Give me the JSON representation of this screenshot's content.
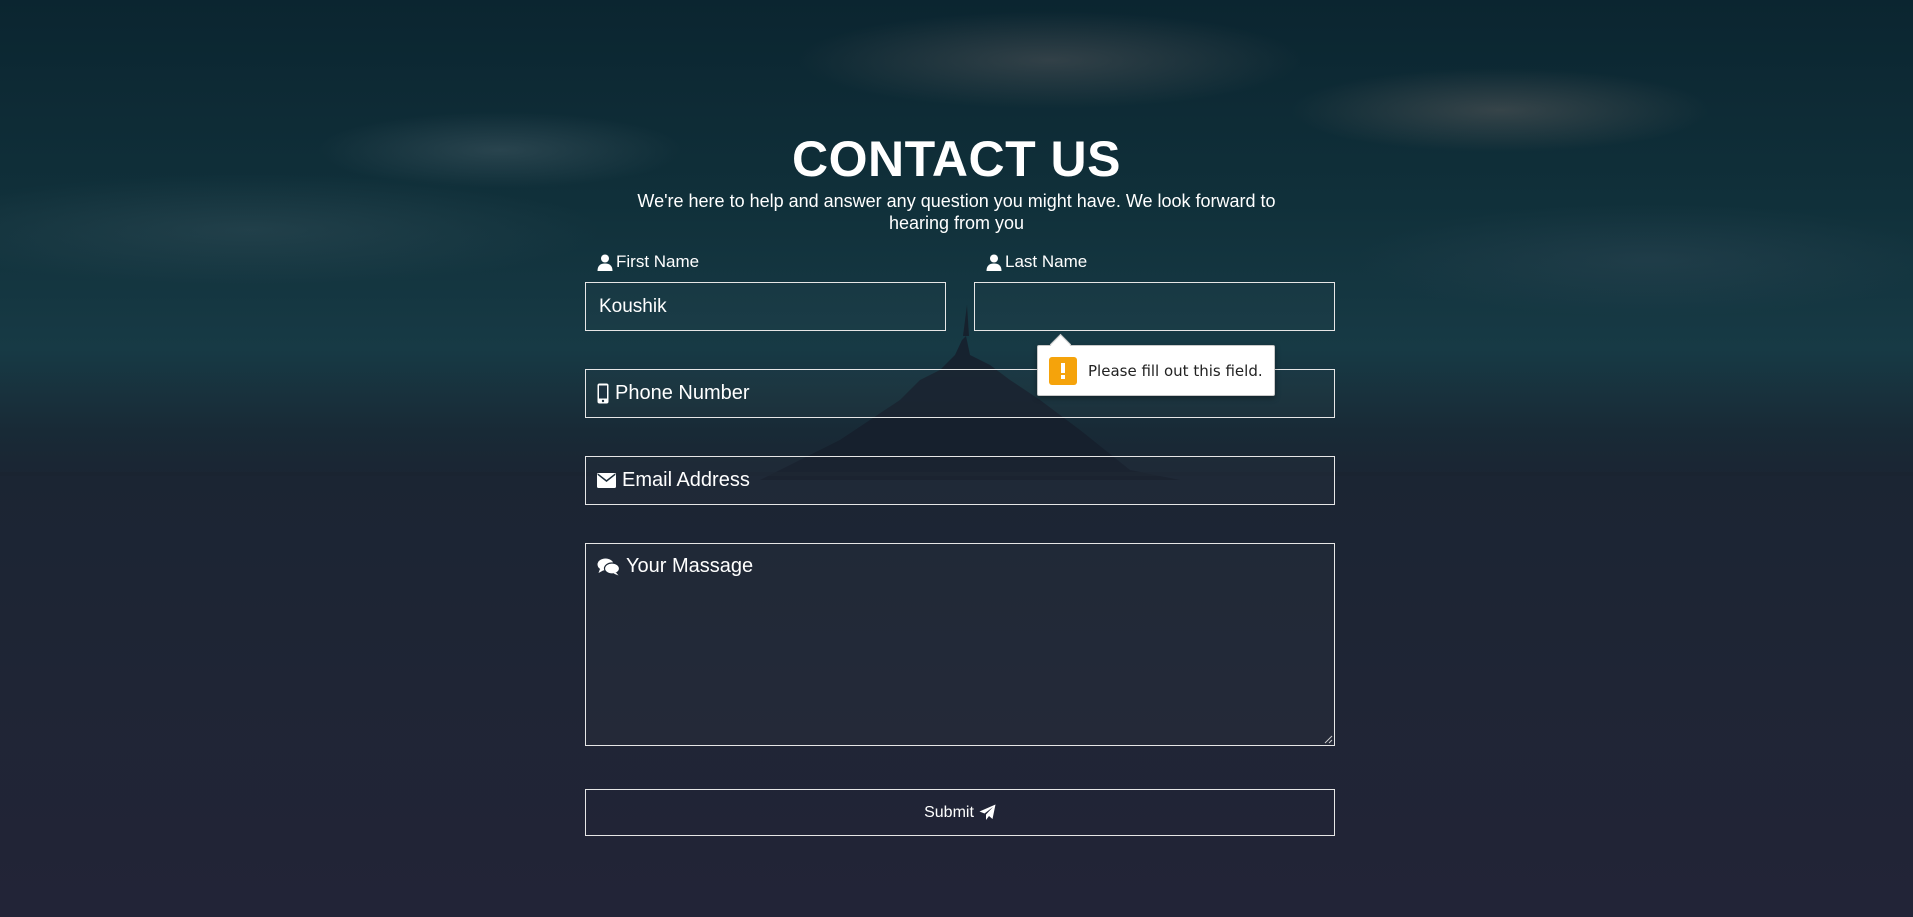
{
  "header": {
    "title": "CONTACT US",
    "subtitle": "We're here to help and answer any question you might have. We look forward to hearing from you"
  },
  "form": {
    "first_name": {
      "label": "First Name",
      "icon": "user-icon",
      "value": "Koushik"
    },
    "last_name": {
      "label": "Last Name",
      "icon": "user-icon",
      "value": ""
    },
    "phone": {
      "placeholder": "Phone Number",
      "icon": "mobile-phone-icon"
    },
    "email": {
      "placeholder": "Email Address",
      "icon": "envelope-icon"
    },
    "message": {
      "placeholder": "Your Massage",
      "icon": "comments-icon"
    },
    "submit": {
      "label": "Submit",
      "icon": "paper-plane-icon"
    }
  },
  "validation_tooltip": {
    "message": "Please fill out this field.",
    "icon": "warning-icon",
    "icon_color": "#f5a30b"
  },
  "colors": {
    "text": "#ffffff",
    "border": "#e6e6e6"
  }
}
